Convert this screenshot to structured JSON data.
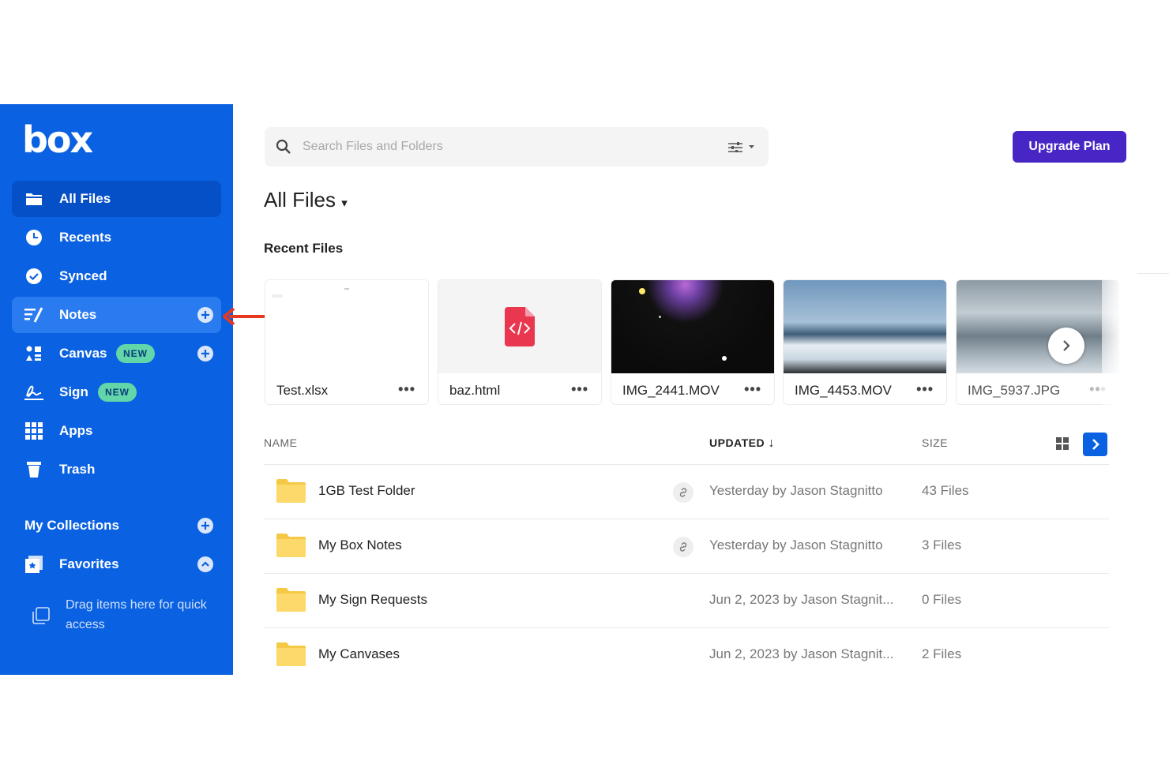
{
  "app": {
    "logo": "box"
  },
  "sidebar": {
    "items": [
      {
        "label": "All Files"
      },
      {
        "label": "Recents"
      },
      {
        "label": "Synced"
      },
      {
        "label": "Notes"
      },
      {
        "label": "Canvas",
        "badge": "NEW"
      },
      {
        "label": "Sign",
        "badge": "NEW"
      },
      {
        "label": "Apps"
      },
      {
        "label": "Trash"
      }
    ],
    "collections_heading": "My Collections",
    "favorites_label": "Favorites",
    "drag_hint": "Drag items here for quick access"
  },
  "search": {
    "placeholder": "Search Files and Folders"
  },
  "header": {
    "upgrade_label": "Upgrade Plan",
    "title": "All Files",
    "title_caret": "▾"
  },
  "recent": {
    "heading": "Recent Files",
    "files": [
      {
        "name": "Test.xlsx",
        "more": "•••"
      },
      {
        "name": "baz.html",
        "more": "•••"
      },
      {
        "name": "IMG_2441.MOV",
        "more": "•••"
      },
      {
        "name": "IMG_4453.MOV",
        "more": "•••"
      },
      {
        "name": "IMG_5937.JPG",
        "more": "•••"
      }
    ]
  },
  "table": {
    "columns": {
      "name": "NAME",
      "updated": "UPDATED",
      "updated_sort": "↓",
      "size": "SIZE"
    },
    "rows": [
      {
        "name": "1GB Test Folder",
        "updated": "Yesterday by Jason Stagnitto",
        "size": "43 Files",
        "shared": true
      },
      {
        "name": "My Box Notes",
        "updated": "Yesterday by Jason Stagnitto",
        "size": "3 Files",
        "shared": true
      },
      {
        "name": "My Sign Requests",
        "updated": "Jun 2, 2023 by Jason Stagnit...",
        "size": "0 Files",
        "shared": false
      },
      {
        "name": "My Canvases",
        "updated": "Jun 2, 2023 by Jason Stagnit...",
        "size": "2 Files",
        "shared": false
      }
    ]
  },
  "colors": {
    "sidebar": "#0a61e1",
    "upgrade": "#4826c6",
    "badge": "#62d6a9",
    "folder": "#fcd96a",
    "annotation_arrow": "#e8381f"
  }
}
